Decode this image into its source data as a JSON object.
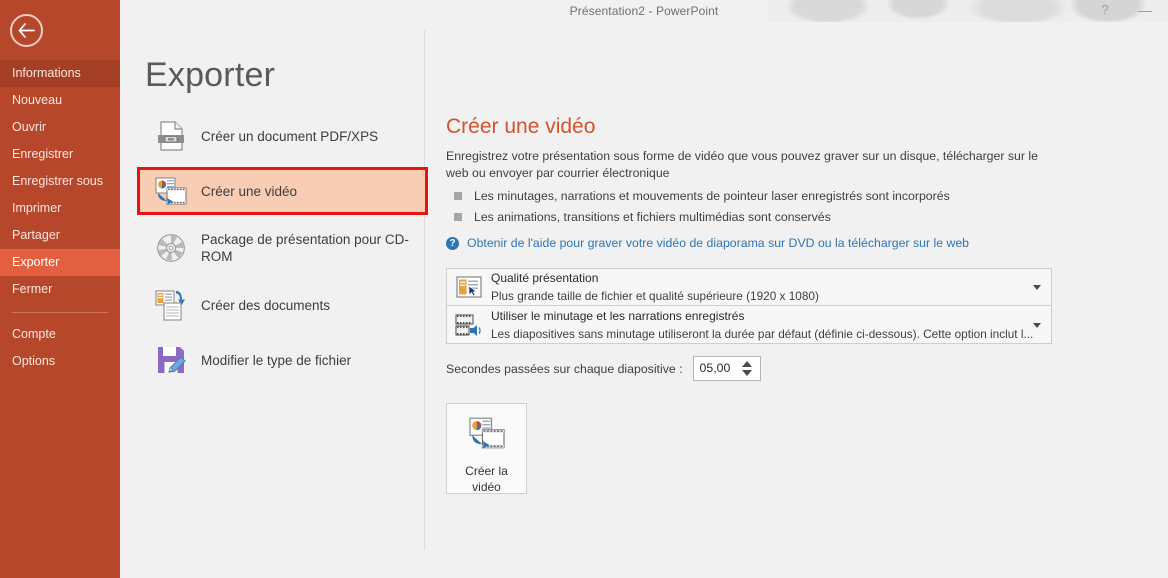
{
  "window": {
    "title": "Présentation2 - PowerPoint",
    "help_icon": "?",
    "minimize_icon": "—"
  },
  "sidebar": {
    "back_icon": "back-arrow-icon",
    "accent_color": "#b7472a",
    "selected_color": "#e2603f",
    "items": [
      {
        "label": "Informations",
        "state": "hover"
      },
      {
        "label": "Nouveau",
        "state": "normal"
      },
      {
        "label": "Ouvrir",
        "state": "normal"
      },
      {
        "label": "Enregistrer",
        "state": "normal"
      },
      {
        "label": "Enregistrer sous",
        "state": "normal"
      },
      {
        "label": "Imprimer",
        "state": "normal"
      },
      {
        "label": "Partager",
        "state": "normal"
      },
      {
        "label": "Exporter",
        "state": "selected"
      },
      {
        "label": "Fermer",
        "state": "normal"
      }
    ],
    "footer_items": [
      {
        "label": "Compte"
      },
      {
        "label": "Options"
      }
    ]
  },
  "page": {
    "title": "Exporter"
  },
  "export_options": [
    {
      "label": "Créer un document PDF/XPS",
      "icon": "pdf-document-icon",
      "selected": false
    },
    {
      "label": "Créer une vidéo",
      "icon": "create-video-icon",
      "selected": true
    },
    {
      "label": "Package de présentation pour CD-ROM",
      "icon": "cd-rom-icon",
      "selected": false
    },
    {
      "label": "Créer des documents",
      "icon": "create-handouts-icon",
      "selected": false
    },
    {
      "label": "Modifier le type de fichier",
      "icon": "change-file-type-icon",
      "selected": false
    }
  ],
  "detail": {
    "heading": "Créer une vidéo",
    "heading_color": "#d2532c",
    "description": "Enregistrez votre présentation sous forme de vidéo que vous pouvez graver sur un disque, télécharger sur le web ou envoyer par courrier électronique",
    "bullets": [
      "Les minutages, narrations et mouvements de pointeur laser enregistrés sont incorporés",
      "Les animations, transitions et fichiers multimédias sont conservés"
    ],
    "help_link": "Obtenir de l'aide pour graver votre vidéo de diaporama sur DVD ou la télécharger sur le web",
    "help_link_color": "#2e75b6",
    "combos": [
      {
        "icon": "presentation-quality-icon",
        "title": "Qualité présentation",
        "subtitle": "Plus grande taille de fichier et qualité supérieure (1920 x 1080)",
        "arrow": "chevron-down-icon"
      },
      {
        "icon": "film-audio-icon",
        "title": "Utiliser le minutage et les narrations enregistrés",
        "subtitle": "Les diapositives sans minutage utiliseront la durée par défaut (définie ci-dessous). Cette option inclut l...",
        "arrow": "chevron-down-icon"
      }
    ],
    "seconds": {
      "label": "Secondes passées sur chaque diapositive :",
      "value": "05,00"
    },
    "create_button": {
      "line1": "Créer la",
      "line2": "vidéo",
      "icon": "create-video-icon"
    }
  }
}
